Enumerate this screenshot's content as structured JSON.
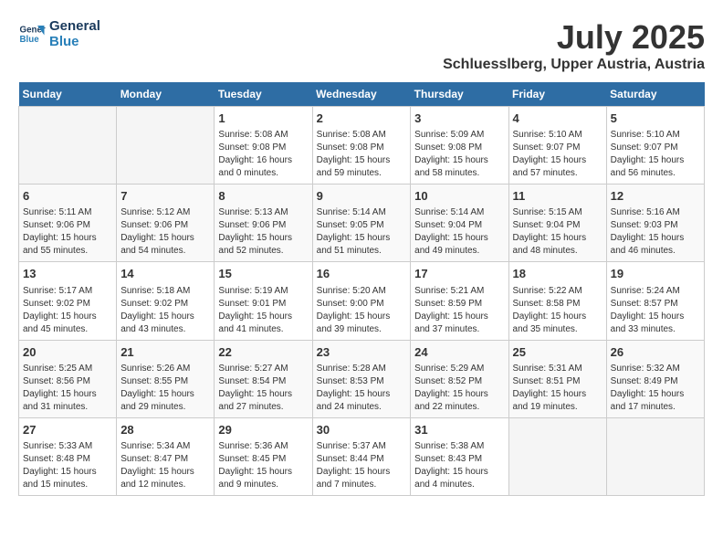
{
  "header": {
    "logo_line1": "General",
    "logo_line2": "Blue",
    "month_year": "July 2025",
    "location": "Schluesslberg, Upper Austria, Austria"
  },
  "weekdays": [
    "Sunday",
    "Monday",
    "Tuesday",
    "Wednesday",
    "Thursday",
    "Friday",
    "Saturday"
  ],
  "weeks": [
    [
      {
        "day": "",
        "info": ""
      },
      {
        "day": "",
        "info": ""
      },
      {
        "day": "1",
        "info": "Sunrise: 5:08 AM\nSunset: 9:08 PM\nDaylight: 16 hours\nand 0 minutes."
      },
      {
        "day": "2",
        "info": "Sunrise: 5:08 AM\nSunset: 9:08 PM\nDaylight: 15 hours\nand 59 minutes."
      },
      {
        "day": "3",
        "info": "Sunrise: 5:09 AM\nSunset: 9:08 PM\nDaylight: 15 hours\nand 58 minutes."
      },
      {
        "day": "4",
        "info": "Sunrise: 5:10 AM\nSunset: 9:07 PM\nDaylight: 15 hours\nand 57 minutes."
      },
      {
        "day": "5",
        "info": "Sunrise: 5:10 AM\nSunset: 9:07 PM\nDaylight: 15 hours\nand 56 minutes."
      }
    ],
    [
      {
        "day": "6",
        "info": "Sunrise: 5:11 AM\nSunset: 9:06 PM\nDaylight: 15 hours\nand 55 minutes."
      },
      {
        "day": "7",
        "info": "Sunrise: 5:12 AM\nSunset: 9:06 PM\nDaylight: 15 hours\nand 54 minutes."
      },
      {
        "day": "8",
        "info": "Sunrise: 5:13 AM\nSunset: 9:06 PM\nDaylight: 15 hours\nand 52 minutes."
      },
      {
        "day": "9",
        "info": "Sunrise: 5:14 AM\nSunset: 9:05 PM\nDaylight: 15 hours\nand 51 minutes."
      },
      {
        "day": "10",
        "info": "Sunrise: 5:14 AM\nSunset: 9:04 PM\nDaylight: 15 hours\nand 49 minutes."
      },
      {
        "day": "11",
        "info": "Sunrise: 5:15 AM\nSunset: 9:04 PM\nDaylight: 15 hours\nand 48 minutes."
      },
      {
        "day": "12",
        "info": "Sunrise: 5:16 AM\nSunset: 9:03 PM\nDaylight: 15 hours\nand 46 minutes."
      }
    ],
    [
      {
        "day": "13",
        "info": "Sunrise: 5:17 AM\nSunset: 9:02 PM\nDaylight: 15 hours\nand 45 minutes."
      },
      {
        "day": "14",
        "info": "Sunrise: 5:18 AM\nSunset: 9:02 PM\nDaylight: 15 hours\nand 43 minutes."
      },
      {
        "day": "15",
        "info": "Sunrise: 5:19 AM\nSunset: 9:01 PM\nDaylight: 15 hours\nand 41 minutes."
      },
      {
        "day": "16",
        "info": "Sunrise: 5:20 AM\nSunset: 9:00 PM\nDaylight: 15 hours\nand 39 minutes."
      },
      {
        "day": "17",
        "info": "Sunrise: 5:21 AM\nSunset: 8:59 PM\nDaylight: 15 hours\nand 37 minutes."
      },
      {
        "day": "18",
        "info": "Sunrise: 5:22 AM\nSunset: 8:58 PM\nDaylight: 15 hours\nand 35 minutes."
      },
      {
        "day": "19",
        "info": "Sunrise: 5:24 AM\nSunset: 8:57 PM\nDaylight: 15 hours\nand 33 minutes."
      }
    ],
    [
      {
        "day": "20",
        "info": "Sunrise: 5:25 AM\nSunset: 8:56 PM\nDaylight: 15 hours\nand 31 minutes."
      },
      {
        "day": "21",
        "info": "Sunrise: 5:26 AM\nSunset: 8:55 PM\nDaylight: 15 hours\nand 29 minutes."
      },
      {
        "day": "22",
        "info": "Sunrise: 5:27 AM\nSunset: 8:54 PM\nDaylight: 15 hours\nand 27 minutes."
      },
      {
        "day": "23",
        "info": "Sunrise: 5:28 AM\nSunset: 8:53 PM\nDaylight: 15 hours\nand 24 minutes."
      },
      {
        "day": "24",
        "info": "Sunrise: 5:29 AM\nSunset: 8:52 PM\nDaylight: 15 hours\nand 22 minutes."
      },
      {
        "day": "25",
        "info": "Sunrise: 5:31 AM\nSunset: 8:51 PM\nDaylight: 15 hours\nand 19 minutes."
      },
      {
        "day": "26",
        "info": "Sunrise: 5:32 AM\nSunset: 8:49 PM\nDaylight: 15 hours\nand 17 minutes."
      }
    ],
    [
      {
        "day": "27",
        "info": "Sunrise: 5:33 AM\nSunset: 8:48 PM\nDaylight: 15 hours\nand 15 minutes."
      },
      {
        "day": "28",
        "info": "Sunrise: 5:34 AM\nSunset: 8:47 PM\nDaylight: 15 hours\nand 12 minutes."
      },
      {
        "day": "29",
        "info": "Sunrise: 5:36 AM\nSunset: 8:45 PM\nDaylight: 15 hours\nand 9 minutes."
      },
      {
        "day": "30",
        "info": "Sunrise: 5:37 AM\nSunset: 8:44 PM\nDaylight: 15 hours\nand 7 minutes."
      },
      {
        "day": "31",
        "info": "Sunrise: 5:38 AM\nSunset: 8:43 PM\nDaylight: 15 hours\nand 4 minutes."
      },
      {
        "day": "",
        "info": ""
      },
      {
        "day": "",
        "info": ""
      }
    ]
  ]
}
